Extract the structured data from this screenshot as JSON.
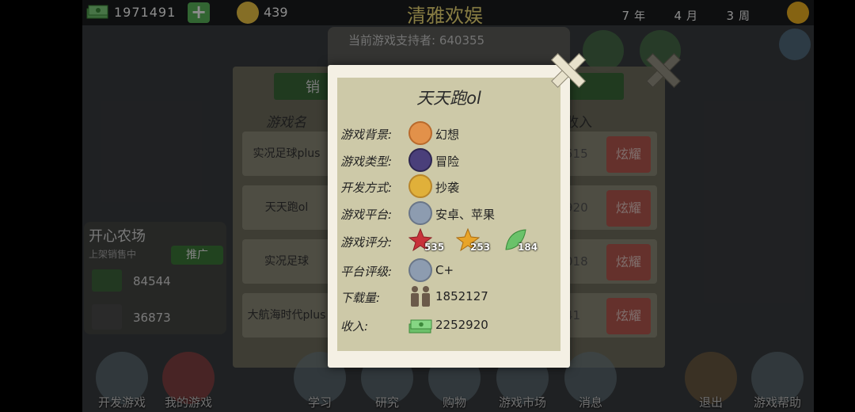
{
  "topbar": {
    "money": "1971491",
    "add_label": "+",
    "coins": "439",
    "company": "清雅欢娱",
    "year": "7",
    "year_unit": "年",
    "month": "4",
    "month_unit": "月",
    "week": "3",
    "week_unit": "周"
  },
  "background": {
    "support_label": "当前游戏支持者:",
    "support_value": "640355"
  },
  "side_card": {
    "title": "开心农场",
    "status": "上架销售中",
    "promote_label": "推广",
    "money": "84544",
    "players": "36873"
  },
  "sales_panel": {
    "tab_sales": "销",
    "col_game": "游戏名",
    "col_income": "收入",
    "flaunt_label": "炫耀",
    "rows": [
      {
        "name": "实况足球plus",
        "num": "515"
      },
      {
        "name": "天天跑ol",
        "num": "920"
      },
      {
        "name": "实况足球",
        "num": "018"
      },
      {
        "name": "大航海时代plus",
        "num": "41"
      }
    ]
  },
  "bottom_nav": [
    {
      "label": "开发游戏"
    },
    {
      "label": "我的游戏"
    },
    {
      "label": "学习"
    },
    {
      "label": "研究"
    },
    {
      "label": "购物"
    },
    {
      "label": "游戏市场"
    },
    {
      "label": "消息"
    },
    {
      "label": "退出"
    },
    {
      "label": "游戏帮助"
    }
  ],
  "dialog": {
    "title": "天天跑ol",
    "background_label": "游戏背景:",
    "background_value": "幻想",
    "type_label": "游戏类型:",
    "type_value": "冒险",
    "dev_label": "开发方式:",
    "dev_value": "抄袭",
    "platform_label": "游戏平台:",
    "platform_value": "安卓、苹果",
    "rating_label": "游戏评分:",
    "rating_red": "535",
    "rating_gold": "253",
    "rating_green": "184",
    "grade_label": "平台评级:",
    "grade_value": "C+",
    "downloads_label": "下载量:",
    "downloads_value": "1852127",
    "income_label": "收入:",
    "income_value": "2252920"
  },
  "icons": {
    "money": "cash-stack-icon",
    "coin": "coin-face-icon",
    "progress": "week-progress-icon",
    "close": "close-icon"
  }
}
